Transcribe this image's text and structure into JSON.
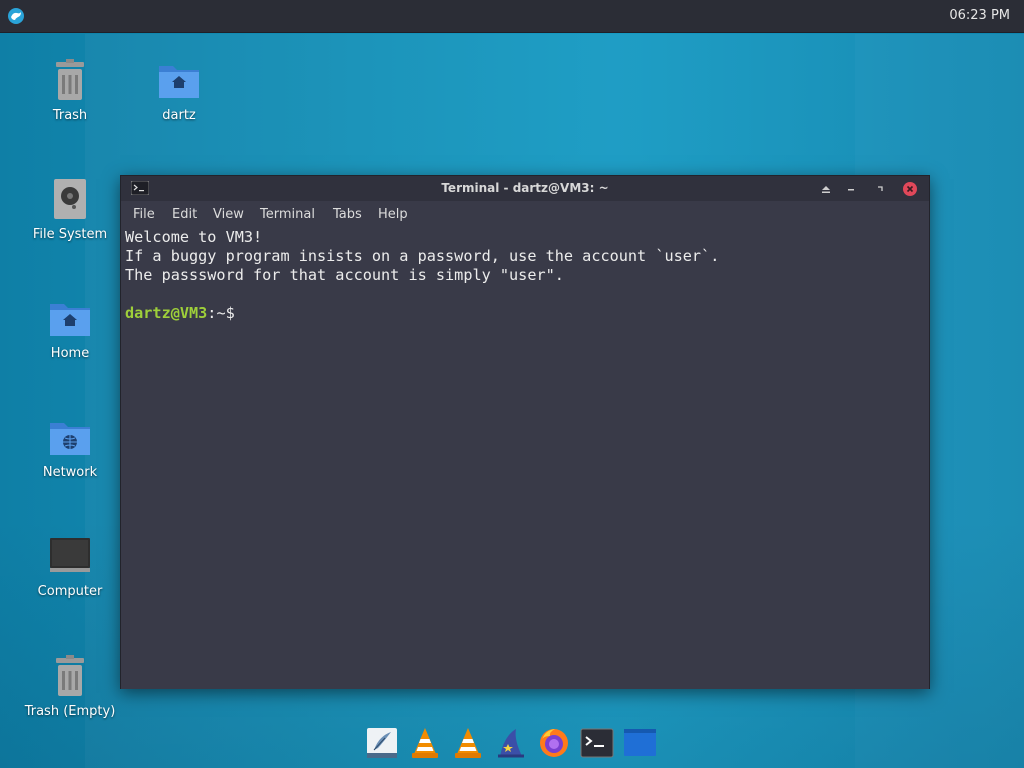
{
  "panel": {
    "clock": "06:23 PM"
  },
  "desktop_icons": [
    {
      "label": "Trash",
      "icon": "trash-icon"
    },
    {
      "label": "dartz",
      "icon": "home-folder-icon"
    },
    {
      "label": "File System",
      "icon": "drive-icon"
    },
    {
      "label": "Home",
      "icon": "home-folder-icon"
    },
    {
      "label": "Network",
      "icon": "network-folder-icon"
    },
    {
      "label": "Computer",
      "icon": "computer-icon"
    },
    {
      "label": "Trash (Empty)",
      "icon": "trash-icon"
    }
  ],
  "terminal": {
    "title": "Terminal - dartz@VM3: ~",
    "menu": [
      "File",
      "Edit",
      "View",
      "Terminal",
      "Tabs",
      "Help"
    ],
    "lines": [
      "Welcome to VM3!",
      "If a buggy program insists on a password, use the account `user`.",
      "The passsword for that account is simply \"user\".",
      ""
    ],
    "prompt_user": "dartz@VM3",
    "prompt_path": ":~$"
  },
  "dock": [
    "text-editor-icon",
    "vlc-icon",
    "vlc-icon",
    "wizard-icon",
    "firefox-icon",
    "terminal-icon",
    "file-manager-icon"
  ],
  "colors": {
    "desktop": "#1390b8",
    "panel": "#2b2d36",
    "terminal_bg": "#393a48",
    "prompt_green": "#9ecf3a",
    "close_red": "#e0485a"
  }
}
